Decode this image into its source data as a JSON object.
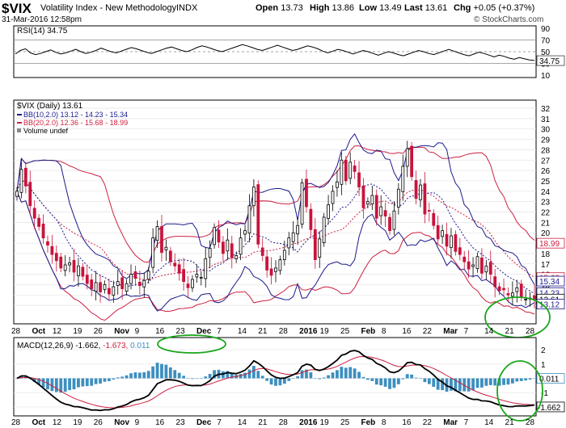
{
  "header": {
    "symbol": "$VIX",
    "name": "Volatility Index - New Methodology",
    "exchange": "INDX",
    "date": "31-Mar-2016 12:58pm",
    "open_label": "Open",
    "open": "13.73",
    "high_label": "High",
    "high": "13.86",
    "low_label": "Low",
    "low": "13.49",
    "last_label": "Last",
    "last": "13.61",
    "chg_label": "Chg",
    "chg": "+0.05 (+0.37%)",
    "brand": "© StockCharts.com"
  },
  "rsi": {
    "label": "RSI(14) 34.75",
    "ticks": [
      "90",
      "70",
      "50",
      "30",
      "10"
    ],
    "last_tag": "34.75",
    "values": [
      46,
      52,
      55,
      48,
      45,
      47,
      50,
      53,
      49,
      46,
      48,
      51,
      54,
      50,
      47,
      49,
      52,
      56,
      53,
      50,
      48,
      51,
      54,
      57,
      55,
      52,
      49,
      47,
      50,
      53,
      56,
      58,
      55,
      52,
      50,
      53,
      57,
      60,
      58,
      55,
      52,
      50,
      53,
      56,
      59,
      62,
      60,
      57,
      54,
      52,
      55,
      58,
      61,
      58,
      55,
      52,
      54,
      57,
      60,
      58,
      55,
      51,
      48,
      51,
      54,
      52,
      49,
      46,
      49,
      52,
      50,
      47,
      44,
      47,
      50,
      48,
      45,
      43,
      46,
      49,
      52,
      50,
      47,
      45,
      48,
      51,
      54,
      51,
      48,
      45,
      43,
      46,
      49,
      47,
      44,
      41,
      44,
      42,
      39,
      37,
      40,
      38,
      36,
      35
    ]
  },
  "legend": {
    "main": "$VIX (Daily) 13.61",
    "bb10": "BB(10,2.0) 13.12 - 14.23 - 15.34",
    "bb20": "BB(20,2.0) 12.36 - 15.68 - 18.99",
    "volume": "Volume undef"
  },
  "tags": [
    {
      "text": "18.99",
      "value": 18.99,
      "color": "#cc1f3f"
    },
    {
      "text": "15.68",
      "value": 15.68,
      "color": "#cc1f3f"
    },
    {
      "text": "15.34",
      "value": 15.34,
      "color": "#1a1a8c"
    },
    {
      "text": "14.23",
      "value": 14.23,
      "color": "#1a1a8c"
    },
    {
      "text": "13.61",
      "value": 13.61,
      "color": "#000000"
    },
    {
      "text": "13.12",
      "value": 13.12,
      "color": "#1a1a8c"
    }
  ],
  "macd": {
    "label_prefix": "MACD(12,26,9)",
    "v1": "-1.662",
    "v2": "-1.673",
    "v3": "0.011",
    "ticks": [
      "2",
      "1",
      "0",
      "-1",
      "-2"
    ],
    "tag_zero": "0.011",
    "tag_macd": "-1.662"
  },
  "colors": {
    "up": "#000000",
    "down": "#c8143c",
    "bb10": "#1a1a8c",
    "bb20": "#cc1f3f",
    "hist": "#3d8fbf",
    "annotate": "#1aa51a"
  },
  "chart_data": {
    "type": "candlestick",
    "title": "$VIX Volatility Index - New Methodology INDX",
    "x_ticks": [
      "28",
      "Oct",
      "12",
      "19",
      "26",
      "Nov",
      "9",
      "16",
      "23",
      "Dec",
      "7",
      "14",
      "21",
      "28",
      "2016",
      "19",
      "25",
      "Feb",
      "8",
      "16",
      "22",
      "Mar",
      "7",
      "14",
      "21",
      "28"
    ],
    "y_ticks": [
      13,
      14,
      15,
      16,
      17,
      18,
      19,
      20,
      21,
      22,
      23,
      24,
      25,
      26,
      27,
      28,
      29,
      30,
      31,
      32
    ],
    "ylim": [
      12,
      32
    ],
    "close": [
      24.0,
      26.1,
      24.5,
      22.6,
      21.4,
      20.6,
      19.5,
      18.8,
      17.9,
      17.3,
      16.6,
      16.9,
      17.1,
      16.2,
      16.8,
      15.8,
      15.1,
      14.6,
      15.2,
      14.3,
      15.0,
      14.1,
      14.8,
      15.3,
      14.6,
      15.1,
      16.0,
      15.6,
      14.9,
      15.4,
      16.3,
      19.5,
      20.6,
      18.1,
      18.6,
      17.2,
      16.8,
      16.1,
      15.3,
      14.7,
      15.5,
      16.0,
      15.7,
      17.5,
      18.5,
      20.5,
      19.1,
      18.0,
      19.3,
      17.6,
      17.8,
      19.5,
      20.2,
      22.6,
      24.4,
      18.9,
      17.8,
      16.4,
      15.9,
      16.6,
      17.4,
      18.3,
      19.5,
      20.0,
      20.7,
      24.8,
      22.5,
      20.3,
      17.4,
      19.4,
      21.5,
      22.7,
      24.0,
      24.9,
      27.0,
      25.0,
      26.8,
      25.9,
      24.4,
      22.4,
      23.0,
      23.6,
      21.4,
      22.5,
      21.6,
      20.2,
      22.1,
      24.2,
      26.4,
      28.1,
      25.4,
      23.3,
      24.6,
      21.8,
      22.1,
      20.7,
      19.4,
      20.2,
      18.7,
      19.7,
      18.2,
      17.9,
      17.2,
      16.5,
      16.9,
      17.7,
      16.1,
      16.8,
      16.0,
      14.8,
      14.4,
      14.5,
      14.0,
      14.2,
      14.7,
      13.8,
      13.6,
      13.7,
      13.6
    ],
    "bb20": {
      "upper": "18.99",
      "middle": "15.68",
      "lower": "12.36"
    },
    "bb10": {
      "upper": "15.34",
      "middle": "14.23",
      "lower": "13.12"
    }
  }
}
